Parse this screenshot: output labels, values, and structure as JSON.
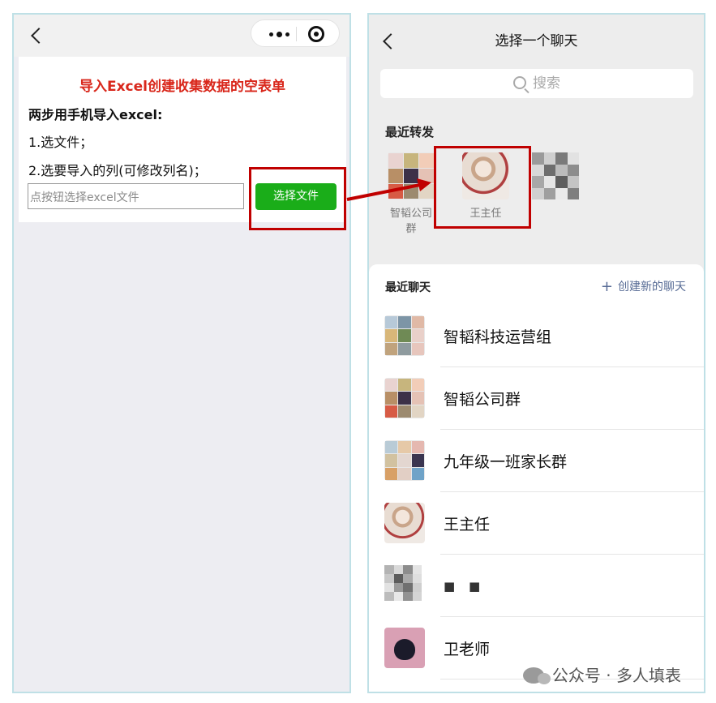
{
  "left": {
    "form_title": "导入Excel创建收集数据的空表单",
    "line1": "两步用手机导入excel:",
    "line2": "1.选文件；",
    "line3": "2.选要导入的列(可修改列名)；",
    "file_placeholder": "点按钮选择excel文件",
    "choose_button": "选择文件"
  },
  "right": {
    "title": "选择一个聊天",
    "search_placeholder": "搜索",
    "recent_forward_label": "最近转发",
    "recent_forward": [
      {
        "name": "智韬公司群",
        "icon": "group-avatar-icon"
      },
      {
        "name": "王主任",
        "icon": "user-avatar-icon"
      },
      {
        "name": "",
        "icon": "blurred-avatar-icon"
      }
    ],
    "recent_chats_label": "最近聊天",
    "new_chat_label": "创建新的聊天",
    "chats": [
      {
        "name": "智韬科技运营组",
        "icon": "group-avatar-icon"
      },
      {
        "name": "智韬公司群",
        "icon": "group-avatar-icon"
      },
      {
        "name": "九年级一班家长群",
        "icon": "group-avatar-icon"
      },
      {
        "name": "王主任",
        "icon": "user-avatar-icon"
      },
      {
        "name": "■ ■",
        "icon": "blurred-avatar-icon"
      },
      {
        "name": "卫老师",
        "icon": "cat-avatar-icon"
      }
    ]
  },
  "watermark": "公众号 · 多人填表",
  "colors": {
    "accent_green": "#1aad19",
    "highlight_red": "#c00000",
    "link_blue": "#576b95",
    "title_red": "#d9271b"
  }
}
